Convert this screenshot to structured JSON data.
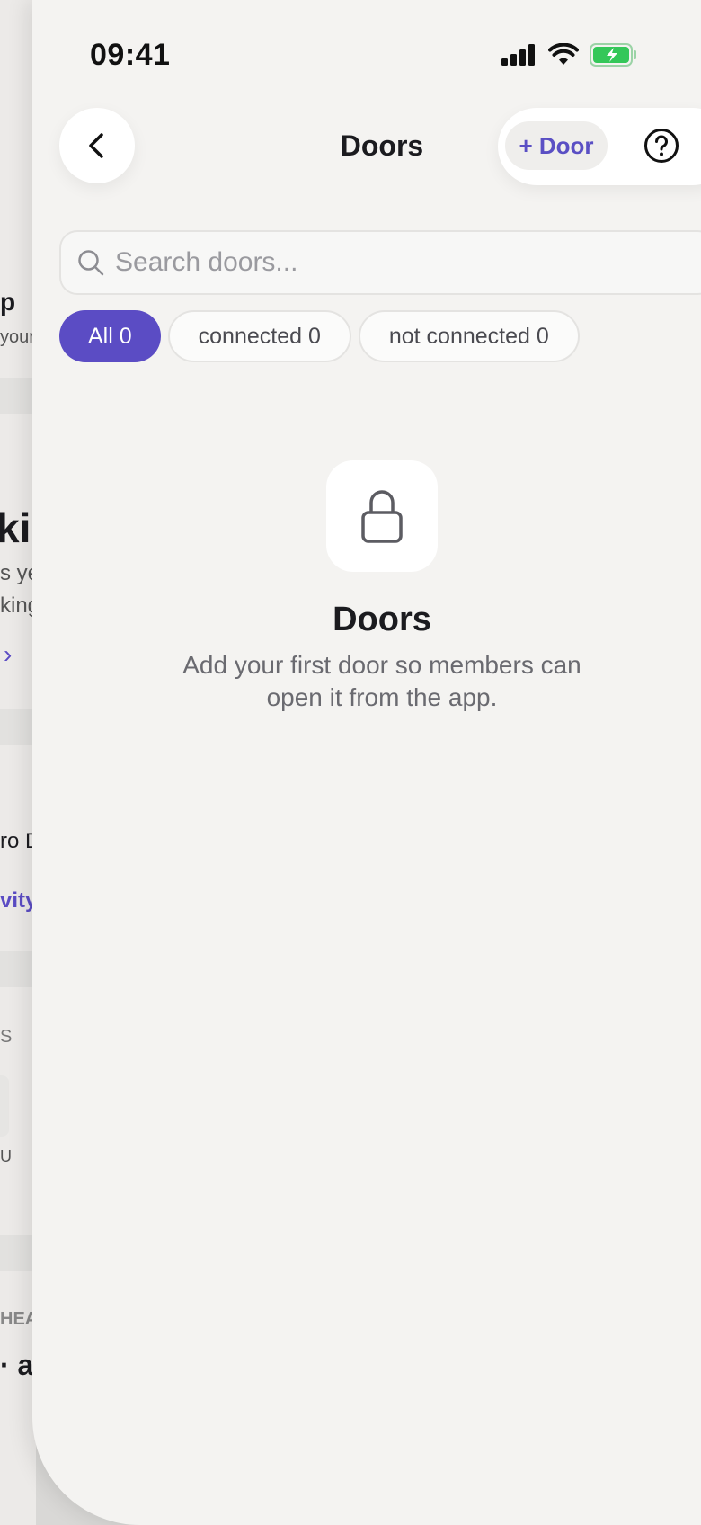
{
  "status_bar": {
    "time": "09:41"
  },
  "header": {
    "title": "Doors",
    "add_label": "+ Door"
  },
  "search": {
    "placeholder": "Search doors..."
  },
  "filters": [
    {
      "label": "All 0",
      "active": true
    },
    {
      "label": "connected 0",
      "active": false
    },
    {
      "label": "not connected 0",
      "active": false
    }
  ],
  "empty_state": {
    "icon": "lock-icon",
    "title": "Doors",
    "description_line1": "Add your first door so members can",
    "description_line2": "open it from the app."
  },
  "background_screen": {
    "fragments": [
      "p",
      "your",
      "kin",
      "s ye",
      "king",
      "ro D",
      "vity",
      "S",
      "U",
      "HEA",
      "· a"
    ]
  },
  "colors": {
    "accent": "#5b4cc4",
    "battery": "#34c759",
    "background": "#f4f3f1"
  }
}
